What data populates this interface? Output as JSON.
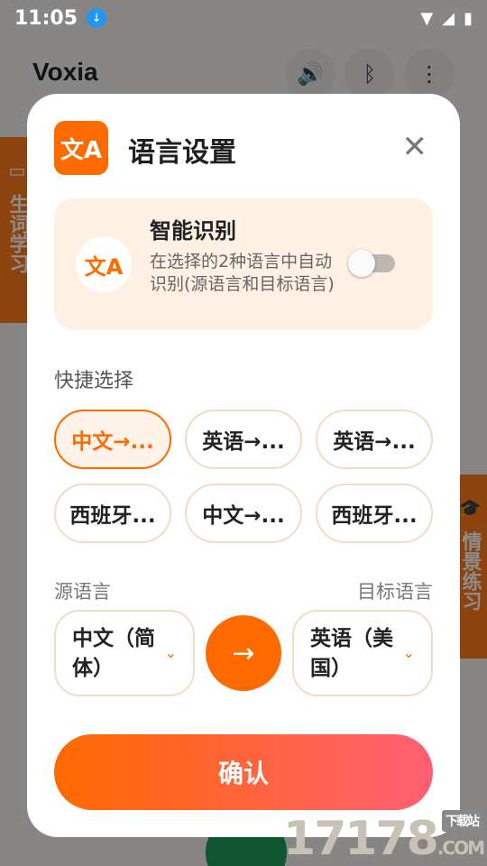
{
  "statusbar": {
    "time": "11:05"
  },
  "app": {
    "title": "Voxia"
  },
  "side_tabs": {
    "left": "生词学习",
    "right": "情景练习"
  },
  "modal": {
    "title": "语言设置",
    "icon_text": "文A",
    "smart": {
      "title": "智能识别",
      "desc": "在选择的2种语言中自动识别(源语言和目标语言)",
      "icon_text": "文A",
      "enabled": false
    },
    "quick_label": "快捷选择",
    "quick_chips": [
      {
        "label": "中文→...",
        "active": true
      },
      {
        "label": "英语→...",
        "active": false
      },
      {
        "label": "英语→...",
        "active": false
      },
      {
        "label": "西班牙...",
        "active": false
      },
      {
        "label": "中文→...",
        "active": false
      },
      {
        "label": "西班牙...",
        "active": false
      }
    ],
    "source_label": "源语言",
    "target_label": "目标语言",
    "source_value": "中文（简体）",
    "target_value": "英语（美国）",
    "confirm_label": "确认"
  },
  "watermark": {
    "text": "17178",
    "tag": "下载站",
    "suffix": ".COM"
  },
  "colors": {
    "accent": "#ff6a00",
    "chip_border": "#f2dcc6",
    "card_bg": "#fff0e4"
  }
}
